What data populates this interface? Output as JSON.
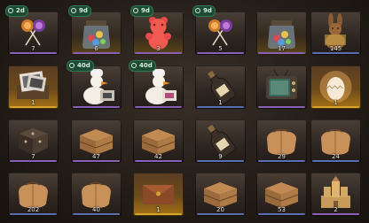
{
  "timers": [
    "2d",
    "9d",
    "9d",
    "9d",
    "40d",
    "40d"
  ],
  "quantities": {
    "row1": [
      "7",
      "6",
      "3",
      "5",
      "17",
      "145"
    ],
    "row2": [
      "1",
      "",
      "",
      "1",
      "",
      "1"
    ],
    "row3": [
      "7",
      "47",
      "42",
      "9",
      "29",
      "24"
    ],
    "row4": [
      "202",
      "40",
      "1",
      "20",
      "53",
      "2"
    ]
  },
  "items": {
    "row1": [
      "lollipops-icon",
      "candy-jar-icon",
      "gummy-bear-icon",
      "lollipops-icon",
      "candy-jar-icon",
      "chocolate-bunny-icon"
    ],
    "row2": [
      "photo-frame-crate-icon",
      "chef-goose-icon",
      "chef-goose-icon",
      "message-bottle-icon",
      "retro-tv-icon",
      "glowing-egg-icon"
    ],
    "row3": [
      "ornate-box-icon",
      "wooden-crate-icon",
      "wooden-crate-icon",
      "message-bottle-icon",
      "burlap-sack-icon",
      "burlap-sack-icon"
    ],
    "row4": [
      "burlap-sack-icon",
      "burlap-sack-icon",
      "leather-envelope-icon",
      "wooden-crate-icon",
      "wooden-crate-icon",
      "sand-castle-icon"
    ]
  },
  "colors": {
    "timer_bg": "#1d4a32",
    "rarity_blue": "#5a6fb0",
    "rarity_purple": "#8a5fb8",
    "rarity_gold": "#d6a32b"
  }
}
